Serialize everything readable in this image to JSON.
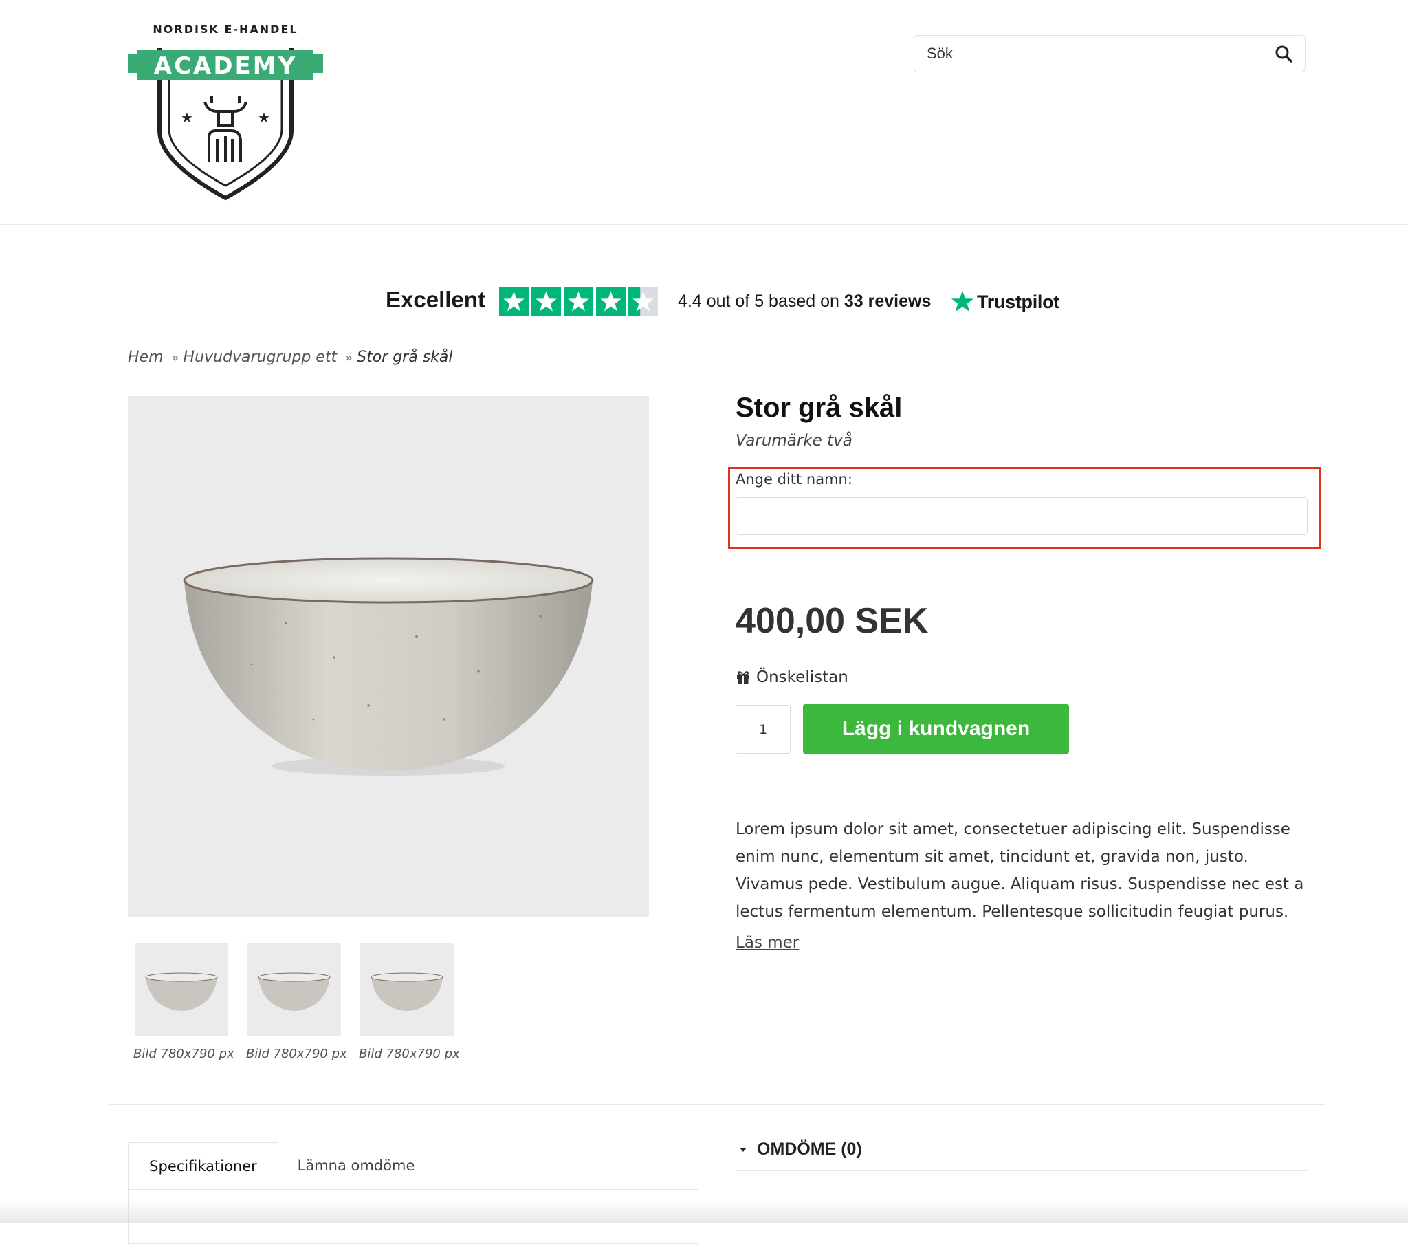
{
  "header": {
    "logo": {
      "top_text": "NORDISK E-HANDEL",
      "banner_text": "ACADEMY",
      "accent_color": "#3aab74"
    },
    "search": {
      "placeholder": "Sök",
      "icon": "search-icon"
    }
  },
  "trustpilot": {
    "rating_word": "Excellent",
    "score_text": "4.4 out of 5 based on",
    "review_count_text": "33 reviews",
    "brand": "Trustpilot",
    "stars": 4.4,
    "star_color": "#00b67a"
  },
  "breadcrumb": {
    "items": [
      "Hem",
      "Huvudvarugrupp ett"
    ],
    "separator": "»",
    "current": "Stor grå skål"
  },
  "product": {
    "title": "Stor grå skål",
    "brand": "Varumärke två",
    "name_field": {
      "label": "Ange ditt namn:",
      "value": ""
    },
    "price": "400,00 SEK",
    "wishlist_label": "Önskelistan",
    "quantity": "1",
    "add_to_cart_label": "Lägg i kundvagnen",
    "add_to_cart_color": "#3cb83c",
    "description": "Lorem ipsum dolor sit amet, consectetuer adipiscing elit. Suspendisse enim nunc, elementum sit amet, tincidunt et, gravida non, justo. Vivamus pede. Vestibulum augue. Aliquam risus. Suspendisse nec est a lectus fermentum elementum. Pellentesque sollicitudin feugiat purus.",
    "read_more_label": "Läs mer",
    "thumbnails": [
      {
        "caption": "Bild 780x790 px"
      },
      {
        "caption": "Bild 780x790 px"
      },
      {
        "caption": "Bild 780x790 px"
      }
    ]
  },
  "tabs": {
    "items": [
      {
        "label": "Specifikationer",
        "active": true
      },
      {
        "label": "Lämna omdöme",
        "active": false
      }
    ]
  },
  "reviews": {
    "heading": "OMDÖME (0)"
  },
  "highlight_color": "#e5301c"
}
